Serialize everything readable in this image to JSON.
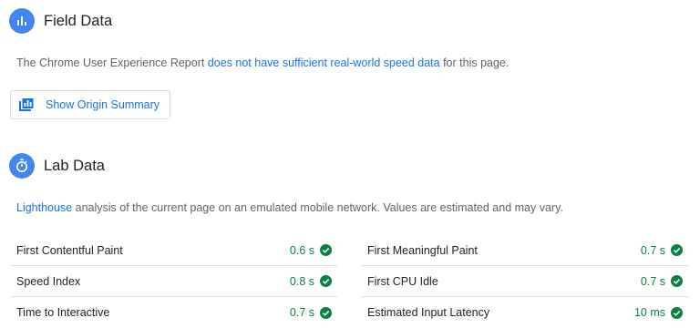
{
  "field_data": {
    "title": "Field Data",
    "icon": "bar-chart-icon",
    "desc_before": "The Chrome User Experience Report ",
    "desc_link": "does not have sufficient real-world speed data",
    "desc_after": " for this page.",
    "button_label": "Show Origin Summary",
    "button_icon": "origin-summary-icon"
  },
  "lab_data": {
    "title": "Lab Data",
    "icon": "stopwatch-icon",
    "desc_link": "Lighthouse",
    "desc_after": " analysis of the current page on an emulated mobile network. Values are estimated and may vary.",
    "metrics_left": [
      {
        "name": "First Contentful Paint",
        "value": "0.6 s"
      },
      {
        "name": "Speed Index",
        "value": "0.8 s"
      },
      {
        "name": "Time to Interactive",
        "value": "0.7 s"
      }
    ],
    "metrics_right": [
      {
        "name": "First Meaningful Paint",
        "value": "0.7 s"
      },
      {
        "name": "First CPU Idle",
        "value": "0.7 s"
      },
      {
        "name": "Estimated Input Latency",
        "value": "10 ms"
      }
    ]
  },
  "colors": {
    "accent": "#4285f4",
    "link": "#1a73e8",
    "pass": "#0b8043"
  }
}
